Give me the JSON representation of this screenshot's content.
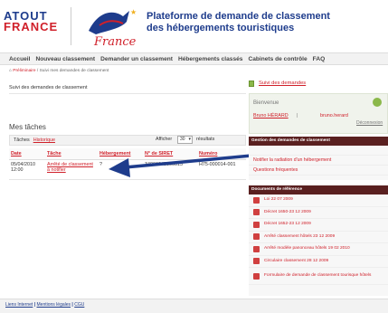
{
  "header": {
    "logo_line1": "ATOUT",
    "logo_line2": "FRANCE",
    "script_logo": "France",
    "title_line1": "Plateforme de demande de classement",
    "title_line2": "des hébergements touristiques"
  },
  "nav": {
    "items": [
      "Accueil",
      "Nouveau classement",
      "Demander un classement",
      "Hébergements classés",
      "Cabinets de contrôle",
      "FAQ"
    ]
  },
  "breadcrumb": {
    "home": "Préliminaire",
    "current": "/ Suivi mes demandes de classement"
  },
  "main": {
    "section_title": "Suivi des demandes de classement",
    "tasks_title": "Mes tâches",
    "tasks_label": "Tâches",
    "history_link": "Historique",
    "afficher_label": "Afficher",
    "per_page_value": "30",
    "results_label": "résultats"
  },
  "table": {
    "columns": [
      "Date",
      "Tâche",
      "Hébergement",
      "N° de SIRET",
      "Numéro"
    ],
    "rows": [
      {
        "date": "05/04/2010 12:00",
        "task": "Arrêté de classement à notifier",
        "hebergement": "?",
        "siret": "34066645500015",
        "numero": "H75-000014-001"
      }
    ]
  },
  "sidebar": {
    "suivi_link": "Suivi des demandes",
    "welcome": {
      "greeting": "Bienvenue",
      "user": "Bruno HÉRARD",
      "separator": "|",
      "email": "bruno.herard",
      "logout": "Déconnexion"
    },
    "gestion_header": "Gestion des demandes de classement",
    "gestion_items": [
      "",
      "Notifier la radiation d'un hébergement",
      "Questions fréquentes"
    ],
    "docs_header": "Documents de référence",
    "docs": [
      "Loi 22 07 2009",
      "Décret 1650-23 12 2009",
      "Décret 1652-23 12 2009",
      "Arrêté classement hôtels 23 12 2009",
      "Arrêté modèle panonceau hôtels 19 02 2010",
      "Circulaire classement 28 12 2009",
      "Formulaire de demande de classement tourisque hôtels"
    ]
  },
  "footer": {
    "links": [
      "Liens Internet",
      "Mentions légales",
      "CGU"
    ],
    "sep": " | "
  },
  "colors": {
    "brand_blue": "#1e3c8c",
    "brand_red": "#d0202a",
    "sidebar_header": "#5a2020",
    "arrow": "#1e3c8c"
  }
}
